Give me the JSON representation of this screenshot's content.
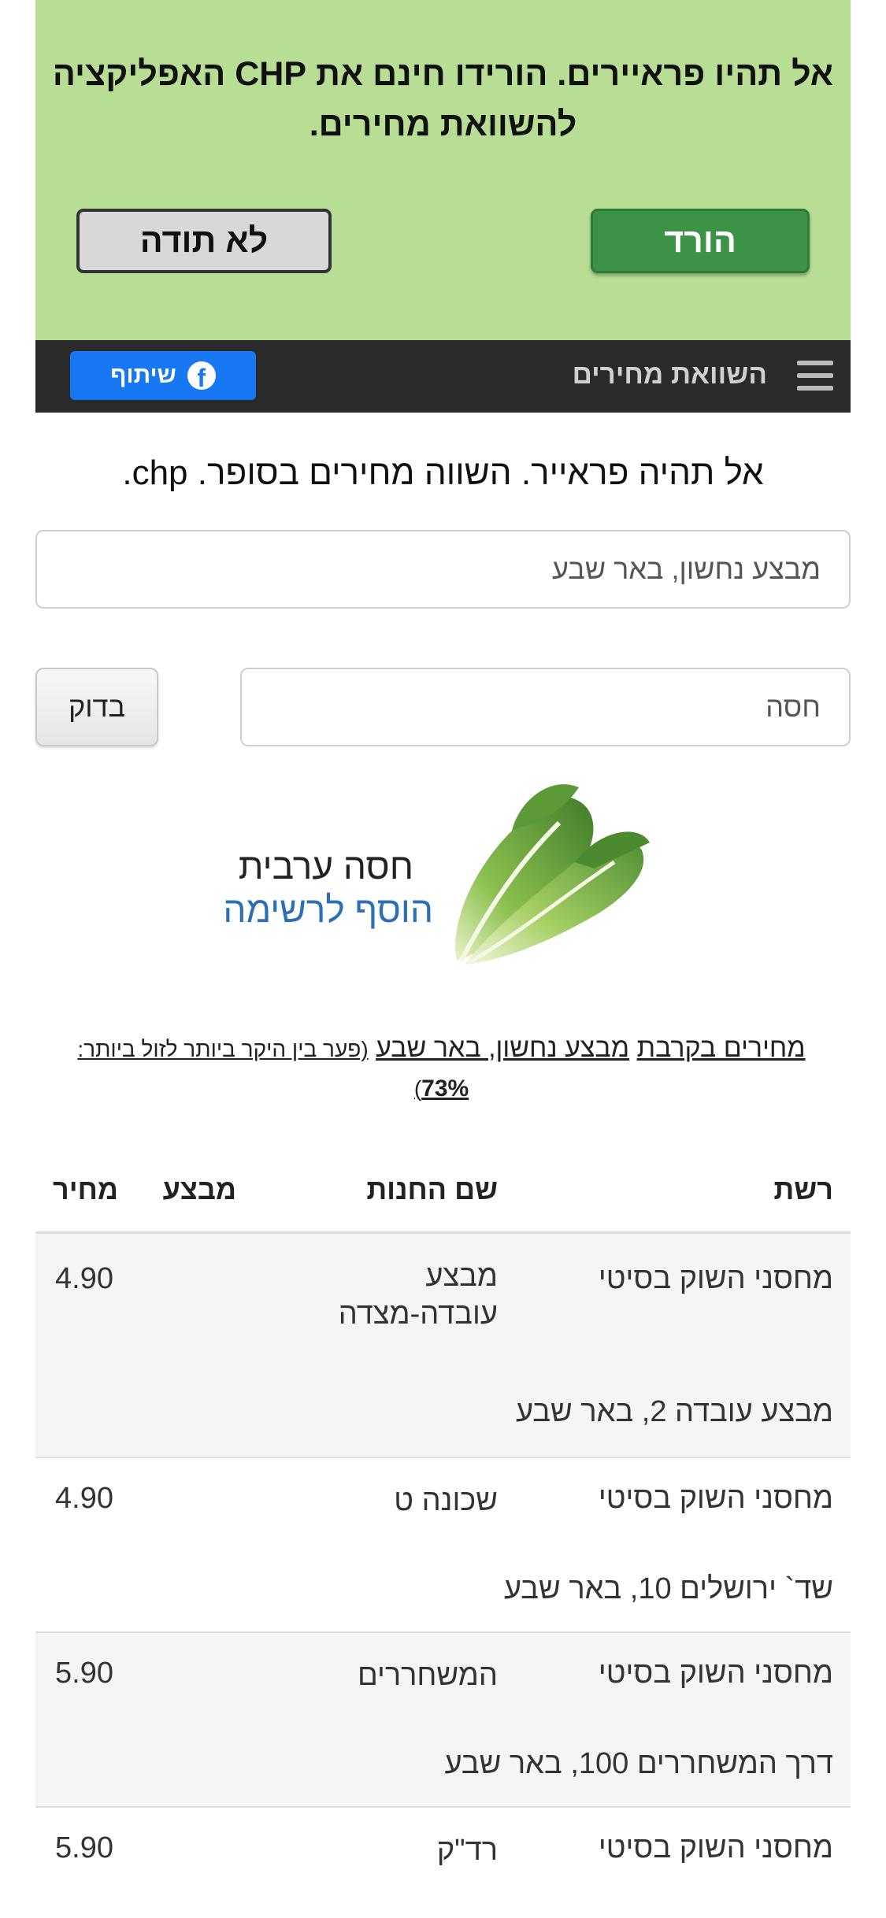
{
  "banner": {
    "text": "אל תהיו פראיירים. הורידו חינם את CHP האפליקציה להשוואת מחירים.",
    "download_label": "הורד",
    "decline_label": "לא תודה"
  },
  "navbar": {
    "title": "השוואת מחירים",
    "share_label": "שיתוף"
  },
  "slogan": "אל תהיה פראייר. השווה מחירים בסופר. chp.",
  "search": {
    "location_value": "מבצע נחשון, באר שבע",
    "product_value": "חסה",
    "check_label": "בדוק"
  },
  "product": {
    "name": "חסה ערבית",
    "add_to_list": "הוסף לרשימה"
  },
  "prices_heading": {
    "prefix": "מחירים בקרבת",
    "location": "מבצע נחשון, באר שבע",
    "gap_text": "(פער בין היקר ביותר לזול ביותר:",
    "gap_value": "73%",
    "gap_close": ")"
  },
  "table": {
    "headers": {
      "chain": "רשת",
      "store": "שם החנות",
      "sale": "מבצע",
      "price": "מחיר"
    },
    "rows": [
      {
        "chain": "מחסני השוק בסיטי",
        "store": "מבצע עובדה-מצדה",
        "sale": "",
        "price": "4.90",
        "address": "מבצע עובדה 2, באר שבע"
      },
      {
        "chain": "מחסני השוק בסיטי",
        "store": "שכונה ט",
        "sale": "",
        "price": "4.90",
        "address": "שד` ירושלים 10, באר שבע"
      },
      {
        "chain": "מחסני השוק בסיטי",
        "store": "המשחררים",
        "sale": "",
        "price": "5.90",
        "address": "דרך המשחררים 100, באר שבע"
      },
      {
        "chain": "מחסני השוק בסיטי",
        "store": "רד\"ק",
        "sale": "",
        "price": "5.90",
        "address": ""
      }
    ]
  },
  "colors": {
    "banner_bg": "#b8dd94",
    "download_button": "#3c9245",
    "navbar_bg": "#2a2a2a",
    "facebook_blue": "#1877f2",
    "link_blue": "#2d6fb4"
  },
  "icons": {
    "menu": "hamburger-icon",
    "facebook": "facebook-icon",
    "product": "lettuce-image"
  }
}
